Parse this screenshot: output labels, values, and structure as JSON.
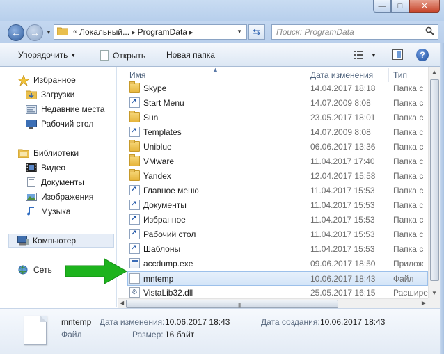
{
  "window": {
    "minimize_glyph": "—",
    "maximize_glyph": "□",
    "close_glyph": "✕"
  },
  "nav": {
    "back_glyph": "←",
    "forward_glyph": "→",
    "address_prefix": "«",
    "address_segments": [
      "Локальный...",
      "ProgramData"
    ],
    "search_placeholder": "Поиск: ProgramData"
  },
  "toolbar": {
    "organize_label": "Упорядочить",
    "open_label": "Открыть",
    "new_folder_label": "Новая папка"
  },
  "sidebar": {
    "favorites": {
      "label": "Избранное",
      "items": [
        "Загрузки",
        "Недавние места",
        "Рабочий стол"
      ]
    },
    "libraries": {
      "label": "Библиотеки",
      "items": [
        "Видео",
        "Документы",
        "Изображения",
        "Музыка"
      ]
    },
    "computer_label": "Компьютер",
    "network_label": "Сеть"
  },
  "columns": {
    "name": "Имя",
    "date": "Дата изменения",
    "type": "Тип"
  },
  "files": [
    {
      "name": "Skype",
      "date": "14.04.2017 18:18",
      "type": "Папка с",
      "icon": "folder"
    },
    {
      "name": "Start Menu",
      "date": "14.07.2009 8:08",
      "type": "Папка с",
      "icon": "shortcut-folder"
    },
    {
      "name": "Sun",
      "date": "23.05.2017 18:01",
      "type": "Папка с",
      "icon": "folder"
    },
    {
      "name": "Templates",
      "date": "14.07.2009 8:08",
      "type": "Папка с",
      "icon": "shortcut-folder"
    },
    {
      "name": "Uniblue",
      "date": "06.06.2017 13:36",
      "type": "Папка с",
      "icon": "folder"
    },
    {
      "name": "VMware",
      "date": "11.04.2017 17:40",
      "type": "Папка с",
      "icon": "folder"
    },
    {
      "name": "Yandex",
      "date": "12.04.2017 15:58",
      "type": "Папка с",
      "icon": "folder"
    },
    {
      "name": "Главное меню",
      "date": "11.04.2017 15:53",
      "type": "Папка с",
      "icon": "shortcut-folder"
    },
    {
      "name": "Документы",
      "date": "11.04.2017 15:53",
      "type": "Папка с",
      "icon": "shortcut-folder"
    },
    {
      "name": "Избранное",
      "date": "11.04.2017 15:53",
      "type": "Папка с",
      "icon": "shortcut-folder"
    },
    {
      "name": "Рабочий стол",
      "date": "11.04.2017 15:53",
      "type": "Папка с",
      "icon": "shortcut-folder"
    },
    {
      "name": "Шаблоны",
      "date": "11.04.2017 15:53",
      "type": "Папка с",
      "icon": "shortcut-folder"
    },
    {
      "name": "accdump.exe",
      "date": "09.06.2017 18:50",
      "type": "Прилож",
      "icon": "exe"
    },
    {
      "name": "mntemp",
      "date": "10.06.2017 18:43",
      "type": "Файл",
      "icon": "file",
      "selected": true
    },
    {
      "name": "VistaLib32.dll",
      "date": "25.05.2017 16:15",
      "type": "Расшире",
      "icon": "dll"
    }
  ],
  "details": {
    "name": "mntemp",
    "kind": "Файл",
    "modified_label": "Дата изменения:",
    "modified_value": "10.06.2017 18:43",
    "created_label": "Дата создания:",
    "created_value": "10.06.2017 18:43",
    "size_label": "Размер:",
    "size_value": "16 байт"
  },
  "colors": {
    "annotation_arrow": "#1db31d",
    "selection": "#d4e5f8"
  }
}
